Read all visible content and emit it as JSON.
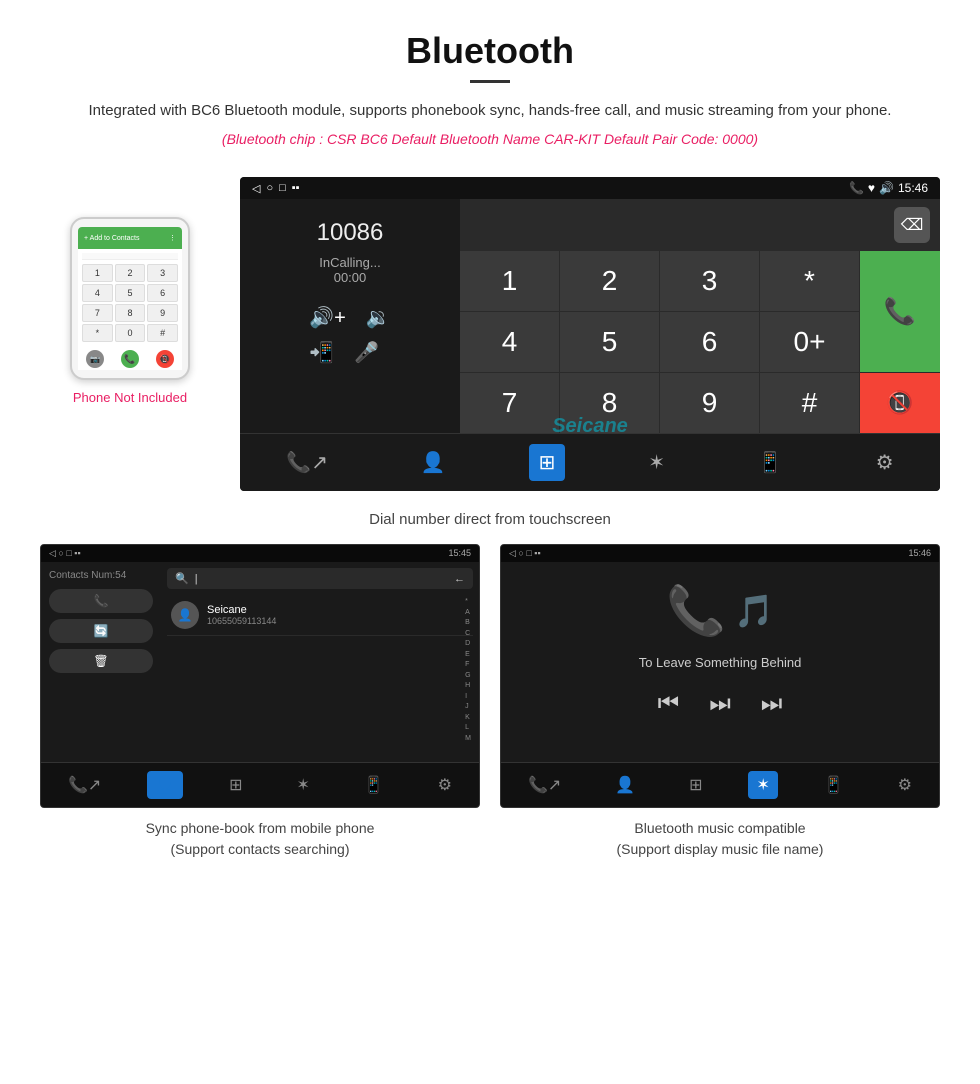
{
  "page": {
    "title": "Bluetooth",
    "divider": true,
    "description": "Integrated with BC6 Bluetooth module, supports phonebook sync, hands-free call, and music streaming from your phone.",
    "specs": "(Bluetooth chip : CSR BC6    Default Bluetooth Name CAR-KIT    Default Pair Code: 0000)",
    "main_caption": "Dial number direct from touchscreen",
    "bottom_left_caption_line1": "Sync phone-book from mobile phone",
    "bottom_left_caption_line2": "(Support contacts searching)",
    "bottom_right_caption_line1": "Bluetooth music compatible",
    "bottom_right_caption_line2": "(Support display music file name)"
  },
  "phone_mockup": {
    "not_included_label": "Phone Not Included",
    "top_bar_text": "+ Add to Contacts",
    "dial_keys": [
      "1",
      "2",
      "3",
      "4",
      "5",
      "6",
      "7",
      "8",
      "9",
      "*",
      "0",
      "#"
    ]
  },
  "dial_screen": {
    "status_bar": {
      "back": "◁",
      "shapes": "○ □",
      "icons": "▪ ▪",
      "right": "📞 ♥ 🔊 15:46"
    },
    "time": "15:46",
    "number": "10086",
    "status": "InCalling...",
    "timer": "00:00",
    "controls": {
      "vol_up": "🔊+",
      "vol_down": "🔉",
      "transfer": "📲",
      "mic": "🎤"
    },
    "keys": [
      "1",
      "2",
      "3",
      "*",
      "4",
      "5",
      "6",
      "0+",
      "7",
      "8",
      "9",
      "#"
    ],
    "call_green_icon": "📞",
    "call_end_icon": "📵",
    "nav": {
      "call_transfer": "📞↗",
      "contacts": "👤",
      "dialpad": "⊞",
      "bluetooth": "✶",
      "phone_transfer": "📱",
      "settings": "⚙"
    }
  },
  "contacts_screen": {
    "status_time": "15:45",
    "contacts_num": "Contacts Num:54",
    "contact_name": "Seicane",
    "contact_number": "10655059113144",
    "search_placeholder": "Search",
    "alphabet": [
      "*",
      "A",
      "B",
      "C",
      "D",
      "E",
      "F",
      "G",
      "H",
      "I",
      "J",
      "K",
      "L",
      "M"
    ],
    "action_call": "📞",
    "action_sync": "🔄",
    "action_delete": "🗑"
  },
  "music_screen": {
    "status_time": "15:46",
    "track_title": "To Leave Something Behind",
    "controls": {
      "prev": "⏮",
      "play_pause": "⏭",
      "next": "⏭"
    }
  },
  "colors": {
    "accent_pink": "#e91e63",
    "accent_green": "#4CAF50",
    "accent_red": "#f44336",
    "accent_blue": "#1976D2",
    "seicane_cyan": "rgba(0,188,212,0.55)",
    "bg_dark": "#1a1a1a",
    "bg_darker": "#111",
    "text_light": "#ccc"
  }
}
